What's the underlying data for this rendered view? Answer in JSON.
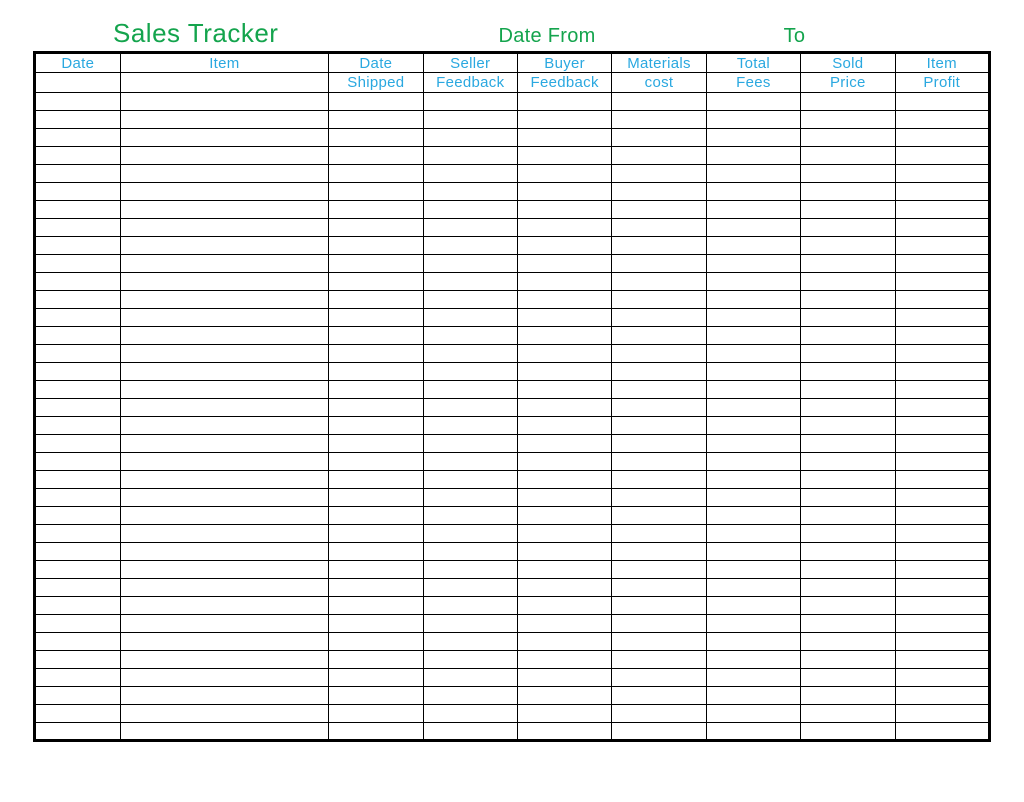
{
  "header": {
    "title": "Sales Tracker",
    "date_from_label": "Date From",
    "to_label": "To"
  },
  "columns": [
    {
      "line1": "Date",
      "line2": ""
    },
    {
      "line1": "Item",
      "line2": ""
    },
    {
      "line1": "Date",
      "line2": "Shipped"
    },
    {
      "line1": "Seller",
      "line2": "Feedback"
    },
    {
      "line1": "Buyer",
      "line2": "Feedback"
    },
    {
      "line1": "Materials",
      "line2": "cost"
    },
    {
      "line1": "Total",
      "line2": "Fees"
    },
    {
      "line1": "Sold",
      "line2": "Price"
    },
    {
      "line1": "Item",
      "line2": "Profit"
    }
  ],
  "row_count": 36,
  "colors": {
    "title_green": "#14a44d",
    "header_blue": "#2aa8e0"
  }
}
